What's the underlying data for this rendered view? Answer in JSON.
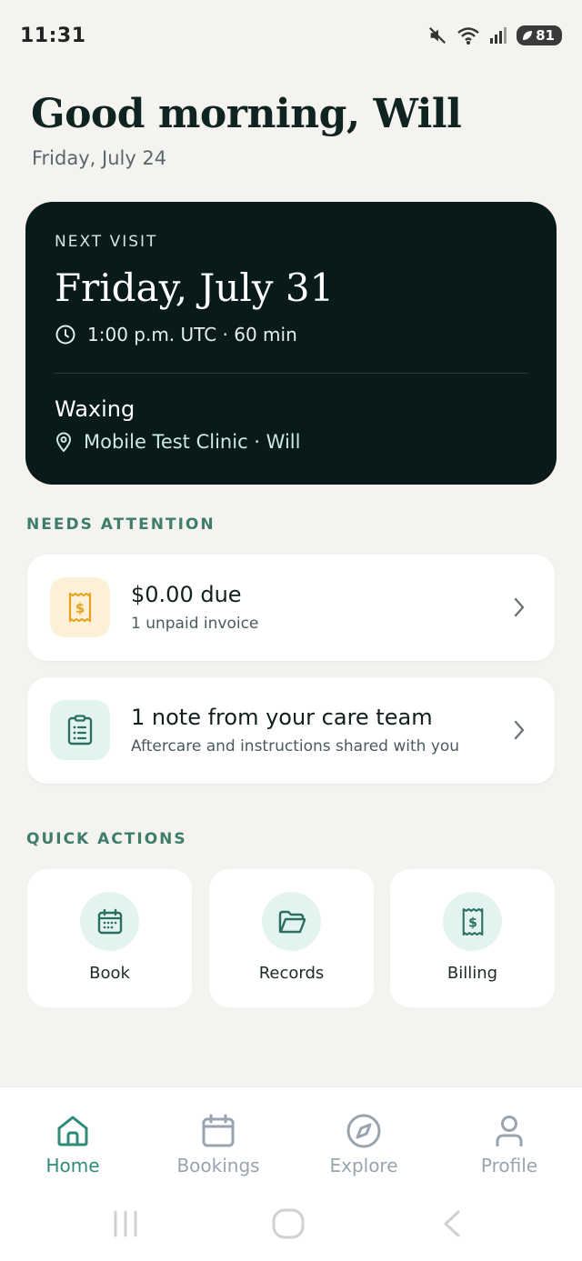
{
  "status_bar": {
    "time": "11:31",
    "battery": "81"
  },
  "greeting": "Good morning, Will",
  "date": "Friday, July 24",
  "next_visit": {
    "eyebrow": "NEXT VISIT",
    "date": "Friday, July 31",
    "time": "1:00 p.m. UTC · 60 min",
    "service": "Waxing",
    "location": "Mobile Test Clinic · Will"
  },
  "needs_attention": {
    "label": "NEEDS ATTENTION",
    "items": [
      {
        "title": "$0.00 due",
        "subtitle": "1 unpaid invoice",
        "icon": "receipt-dollar-icon"
      },
      {
        "title": "1 note from your care team",
        "subtitle": "Aftercare and instructions shared with you",
        "icon": "clipboard-icon"
      }
    ]
  },
  "quick_actions": {
    "label": "QUICK ACTIONS",
    "items": [
      {
        "label": "Book",
        "icon": "calendar-icon"
      },
      {
        "label": "Records",
        "icon": "folder-icon"
      },
      {
        "label": "Billing",
        "icon": "receipt-dollar-icon"
      }
    ]
  },
  "nav": {
    "items": [
      {
        "label": "Home",
        "icon": "home-icon",
        "active": true
      },
      {
        "label": "Bookings",
        "icon": "calendar-icon",
        "active": false
      },
      {
        "label": "Explore",
        "icon": "compass-icon",
        "active": false
      },
      {
        "label": "Profile",
        "icon": "user-icon",
        "active": false
      }
    ]
  },
  "colors": {
    "accent": "#2f8a77",
    "card_dark": "#081a19",
    "warning_bg": "#fdf0d9",
    "warning_icon": "#e8a21c",
    "inactive_nav": "#98a4b0"
  }
}
